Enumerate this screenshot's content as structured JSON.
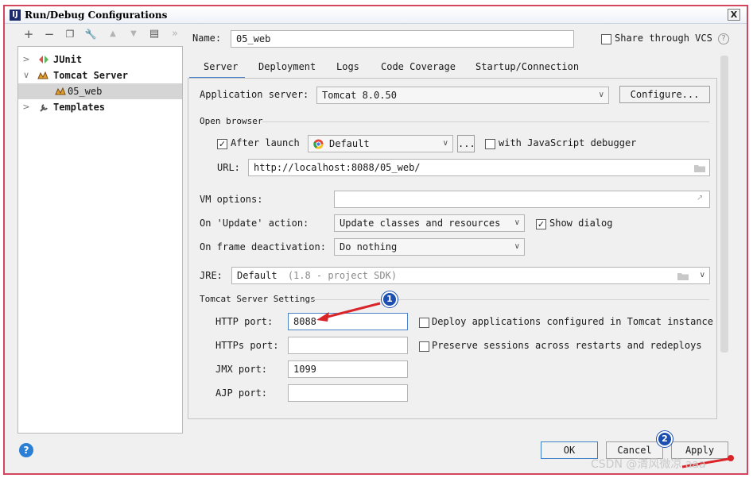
{
  "window": {
    "title": "Run/Debug Configurations",
    "close_label": "X",
    "app_icon_letter": "IJ",
    "border_color": "#d3455c"
  },
  "toolbar": {
    "add": "+",
    "remove": "−",
    "copy": "❐",
    "wrench": "🔧",
    "up": "▲",
    "down": "▼",
    "folder": "▤",
    "more": "»"
  },
  "tree": {
    "items": [
      {
        "label": "JUnit",
        "arrow": ">",
        "icon": "junit-icon"
      },
      {
        "label": "Tomcat Server",
        "arrow": "∨",
        "icon": "tomcat-icon"
      },
      {
        "label": "05_web",
        "icon": "tomcat-config-icon",
        "selected": true
      },
      {
        "label": "Templates",
        "arrow": ">",
        "icon": "wrench-icon"
      }
    ]
  },
  "name": {
    "label": "Name:",
    "value": "05_web",
    "share_label": "Share through VCS",
    "help": "?"
  },
  "tabs": [
    "Server",
    "Deployment",
    "Logs",
    "Code Coverage",
    "Startup/Connection"
  ],
  "server": {
    "app_server_label": "Application server:",
    "app_server_value": "Tomcat 8.0.50",
    "configure_label": "Configure...",
    "open_browser_label": "Open browser",
    "after_launch_label": "After launch",
    "browser_value": "Default",
    "ellipsis": "...",
    "js_debugger_label": "with JavaScript debugger",
    "url_label": "URL:",
    "url_value": "http://localhost:8088/05_web/",
    "vm_options_label": "VM options:",
    "vm_options_value": "",
    "on_update_label": "On 'Update' action:",
    "on_update_value": "Update classes and resources",
    "show_dialog_label": "Show dialog",
    "on_frame_label": "On frame deactivation:",
    "on_frame_value": "Do nothing",
    "jre_label": "JRE:",
    "jre_value": "Default",
    "jre_hint": "(1.8 - project SDK)",
    "tomcat_settings_label": "Tomcat Server Settings",
    "http_port_label": "HTTP port:",
    "http_port_value": "8088",
    "https_port_label": "HTTPs port:",
    "https_port_value": "",
    "jmx_port_label": "JMX port:",
    "jmx_port_value": "1099",
    "ajp_port_label": "AJP port:",
    "ajp_port_value": "",
    "deploy_apps_label": "Deploy applications configured in Tomcat instance",
    "preserve_sessions_label": "Preserve sessions across restarts and redeploys"
  },
  "buttons": {
    "ok": "OK",
    "cancel": "Cancel",
    "apply": "Apply",
    "help": "?"
  },
  "annotations": {
    "badge1": "1",
    "badge2": "2",
    "arrow_color": "#d9252a",
    "badge_color": "#1c4fb0"
  },
  "watermark": "CSDN @清风微凉 aaa"
}
